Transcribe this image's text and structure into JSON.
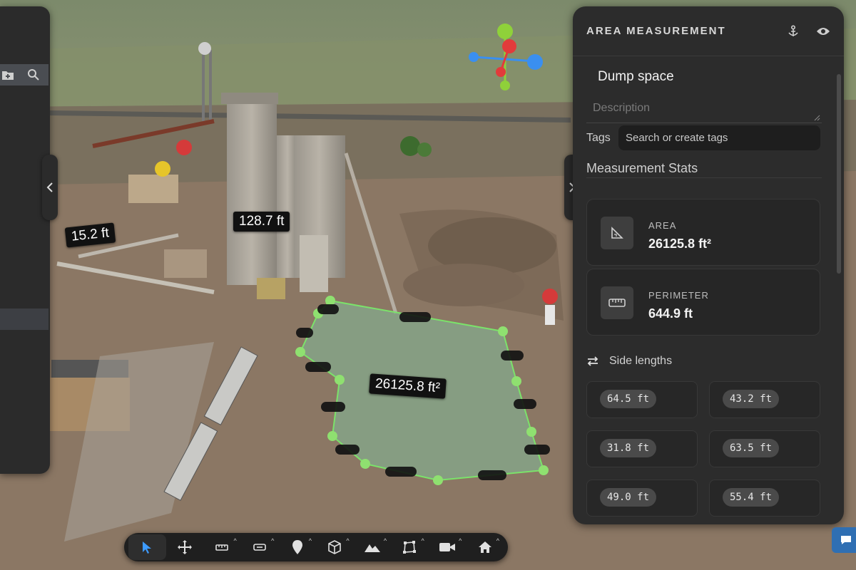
{
  "scene": {
    "labels": {
      "height_a": "15.2 ft",
      "height_b": "128.7 ft",
      "area": "26125.8 ft²"
    }
  },
  "panel": {
    "title": "AREA MEASUREMENT",
    "name": "Dump space",
    "description_placeholder": "Description",
    "tags_label": "Tags",
    "tags_placeholder": "Search or create tags",
    "stats_title": "Measurement Stats",
    "area_label": "AREA",
    "area_value": "26125.8 ft²",
    "perimeter_label": "PERIMETER",
    "perimeter_value": "644.9 ft",
    "side_title": "Side lengths",
    "side_lengths": [
      "64.5 ft",
      "43.2 ft",
      "31.8 ft",
      "63.5 ft",
      "49.0 ft",
      "55.4 ft"
    ]
  },
  "toolbar": {
    "tools": [
      "select-icon",
      "move-icon",
      "ruler-icon",
      "rectangle-icon",
      "pin-icon",
      "cube-icon",
      "terrain-icon",
      "polygon-icon",
      "camera-icon",
      "home-icon"
    ]
  },
  "colors": {
    "accent_green": "#7be36a",
    "gizmo_green": "#8fd13a",
    "gizmo_blue": "#3a8ff0",
    "gizmo_red": "#e23b3b"
  }
}
